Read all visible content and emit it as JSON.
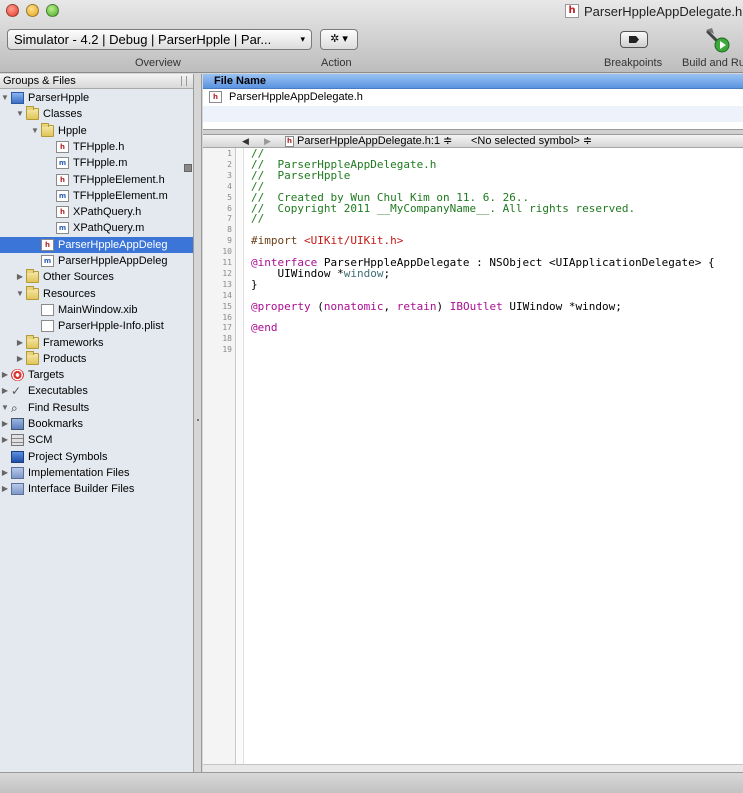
{
  "window": {
    "title": "ParserHppleAppDelegate.h",
    "title_file_type": "h"
  },
  "toolbar": {
    "scheme_popup_value": "Simulator - 4.2 | Debug | ParserHpple | Par...",
    "scheme_popup_arrow": "▾",
    "action_popup_glyph": "✲ ▾",
    "overview_label": "Overview",
    "action_label": "Action",
    "breakpoints_label": "Breakpoints",
    "build_label": "Build and Ru"
  },
  "sidebar": {
    "header": "Groups & Files",
    "items": [
      {
        "label": "ParserHpple",
        "icon": "project-icon",
        "indent": 0,
        "disclosure": "▼"
      },
      {
        "label": "Classes",
        "icon": "folder-icon",
        "indent": 1,
        "disclosure": "▼"
      },
      {
        "label": "Hpple",
        "icon": "folder-icon",
        "indent": 2,
        "disclosure": "▼"
      },
      {
        "label": "TFHpple.h",
        "icon": "header-file-icon",
        "indent": 3,
        "disclosure": ""
      },
      {
        "label": "TFHpple.m",
        "icon": "source-file-icon",
        "indent": 3,
        "disclosure": ""
      },
      {
        "label": "TFHppleElement.h",
        "icon": "header-file-icon",
        "indent": 3,
        "disclosure": ""
      },
      {
        "label": "TFHppleElement.m",
        "icon": "source-file-icon",
        "indent": 3,
        "disclosure": ""
      },
      {
        "label": "XPathQuery.h",
        "icon": "header-file-icon",
        "indent": 3,
        "disclosure": ""
      },
      {
        "label": "XPathQuery.m",
        "icon": "source-file-icon",
        "indent": 3,
        "disclosure": ""
      },
      {
        "label": "ParserHppleAppDeleg",
        "icon": "header-file-icon",
        "indent": 2,
        "disclosure": "",
        "selected": true
      },
      {
        "label": "ParserHppleAppDeleg",
        "icon": "source-file-icon",
        "indent": 2,
        "disclosure": ""
      },
      {
        "label": "Other Sources",
        "icon": "folder-icon",
        "indent": 1,
        "disclosure": "▶"
      },
      {
        "label": "Resources",
        "icon": "folder-icon",
        "indent": 1,
        "disclosure": "▼"
      },
      {
        "label": "MainWindow.xib",
        "icon": "xib-file-icon",
        "indent": 2,
        "disclosure": ""
      },
      {
        "label": "ParserHpple-Info.plist",
        "icon": "plist-file-icon",
        "indent": 2,
        "disclosure": ""
      },
      {
        "label": "Frameworks",
        "icon": "folder-icon",
        "indent": 1,
        "disclosure": "▶"
      },
      {
        "label": "Products",
        "icon": "folder-icon",
        "indent": 1,
        "disclosure": "▶"
      },
      {
        "label": "Targets",
        "icon": "target-icon",
        "indent": 0,
        "disclosure": "▶"
      },
      {
        "label": "Executables",
        "icon": "executable-icon",
        "indent": 0,
        "disclosure": "▶"
      },
      {
        "label": "Find Results",
        "icon": "find-icon",
        "indent": 0,
        "disclosure": "▼"
      },
      {
        "label": "Bookmarks",
        "icon": "bookmarks-icon",
        "indent": 0,
        "disclosure": "▶"
      },
      {
        "label": "SCM",
        "icon": "scm-icon",
        "indent": 0,
        "disclosure": "▶"
      },
      {
        "label": "Project Symbols",
        "icon": "symbols-icon",
        "indent": 0,
        "disclosure": ""
      },
      {
        "label": "Implementation Files",
        "icon": "implementation-files-icon",
        "indent": 0,
        "disclosure": "▶"
      },
      {
        "label": "Interface Builder Files",
        "icon": "interface-builder-files-icon",
        "indent": 0,
        "disclosure": "▶"
      }
    ]
  },
  "filelist": {
    "header": "File Name",
    "rows": [
      {
        "name": "ParserHppleAppDelegate.h",
        "file_type": "h"
      }
    ]
  },
  "editor_nav": {
    "back": "◀",
    "forward": "▶",
    "file_type": "h",
    "file_popup": "ParserHppleAppDelegate.h:1 ≑",
    "symbol_popup": "<No selected symbol> ≑"
  },
  "editor": {
    "line_numbers": [
      "1",
      "2",
      "3",
      "4",
      "5",
      "6",
      "7",
      "8",
      "9",
      "10",
      "11",
      "12",
      "13",
      "14",
      "15",
      "16",
      "17",
      "18",
      "19"
    ],
    "lines": [
      [
        {
          "t": "//",
          "c": "comment"
        }
      ],
      [
        {
          "t": "//  ParserHppleAppDelegate.h",
          "c": "comment"
        }
      ],
      [
        {
          "t": "//  ParserHpple",
          "c": "comment"
        }
      ],
      [
        {
          "t": "//",
          "c": "comment"
        }
      ],
      [
        {
          "t": "//  Created by Wun Chul Kim on 11. 6. 26..",
          "c": "comment"
        }
      ],
      [
        {
          "t": "//  Copyright 2011 __MyCompanyName__. All rights reserved.",
          "c": "comment"
        }
      ],
      [
        {
          "t": "//",
          "c": "comment"
        }
      ],
      [],
      [
        {
          "t": "#import ",
          "c": "pre"
        },
        {
          "t": "<UIKit/UIKit.h>",
          "c": "str"
        }
      ],
      [],
      [
        {
          "t": "@interface",
          "c": "kw"
        },
        {
          "t": " ParserHppleAppDelegate : NSObject <UIApplicationDelegate> {",
          "c": "plain"
        }
      ],
      [
        {
          "t": "    UIWindow *",
          "c": "plain"
        },
        {
          "t": "window",
          "c": "type"
        },
        {
          "t": ";",
          "c": "plain"
        }
      ],
      [
        {
          "t": "}",
          "c": "plain"
        }
      ],
      [],
      [
        {
          "t": "@property",
          "c": "kw"
        },
        {
          "t": " (",
          "c": "plain"
        },
        {
          "t": "nonatomic",
          "c": "kw"
        },
        {
          "t": ", ",
          "c": "plain"
        },
        {
          "t": "retain",
          "c": "kw"
        },
        {
          "t": ") ",
          "c": "plain"
        },
        {
          "t": "IBOutlet",
          "c": "kw"
        },
        {
          "t": " UIWindow *window;",
          "c": "plain"
        }
      ],
      [],
      [
        {
          "t": "@end",
          "c": "kw"
        }
      ],
      [],
      []
    ]
  }
}
